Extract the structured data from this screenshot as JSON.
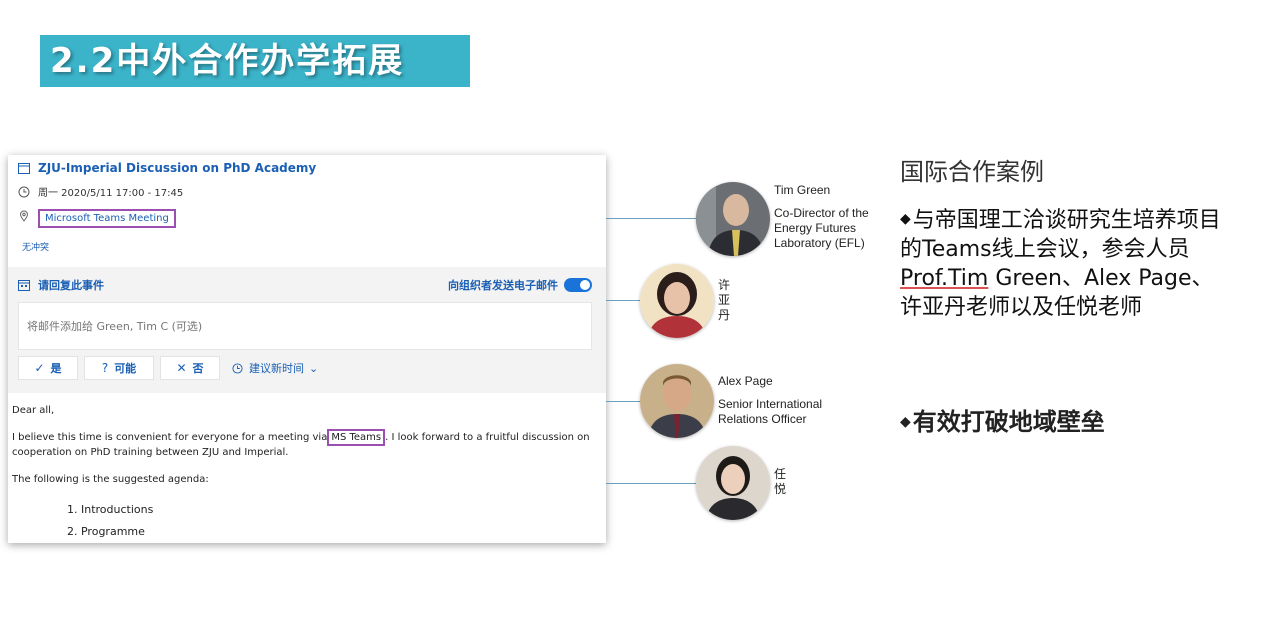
{
  "slide": {
    "title": "2.2中外合作办学拓展",
    "colors": {
      "title_bg": "#3bb3c9",
      "link": "#1a5fb4",
      "highlight_box": "#9b4fb0",
      "connector": "#6a9fbf"
    }
  },
  "email": {
    "event_title": "ZJU-Imperial Discussion on PhD Academy",
    "event_time": "周一 2020/5/11 17:00 - 17:45",
    "location_link": "Microsoft Teams Meeting",
    "conflict_text": "无冲突",
    "rsvp_label": "请回复此事件",
    "send_response_label": "向组织者发送电子邮件",
    "send_response_on": true,
    "reply_placeholder": "将邮件添加给 Green, Tim C (可选)",
    "buttons": {
      "yes": "是",
      "maybe": "可能",
      "no": "否",
      "propose": "建议新时间"
    },
    "icons": [
      "calendar-icon",
      "clock-icon",
      "location-pin-icon",
      "check-icon",
      "question-icon",
      "x-icon",
      "chevron-down-icon"
    ],
    "body": {
      "greeting": "Dear all,",
      "line1_before": "I believe this time is convenient for everyone for a meeting via",
      "line1_highlight": "MS Teams",
      "line1_after": ". I look forward to a fruitful discussion on cooperation on PhD training between ZJU and Imperial.",
      "agenda_intro": "The following is the suggested agenda:",
      "agenda": [
        "1.  Introductions",
        "2.  Programme"
      ]
    }
  },
  "people": [
    {
      "name": "Tim Green",
      "role": "Co-Director of the Energy Futures Laboratory (EFL)"
    },
    {
      "name": "许亚丹"
    },
    {
      "name": "Alex Page",
      "role": "Senior International Relations Officer"
    },
    {
      "name": "任悦"
    }
  ],
  "case": {
    "heading": "国际合作案例",
    "bullet": "◆",
    "text_part1": "与帝国理工洽谈研究生培养项目的Teams线上会议，参会人员",
    "text_underlined": "Prof.Tim",
    "text_part2": " Green、Alex Page、许亚丹老师以及任悦老师",
    "highlight": "有效打破地域壁垒"
  }
}
